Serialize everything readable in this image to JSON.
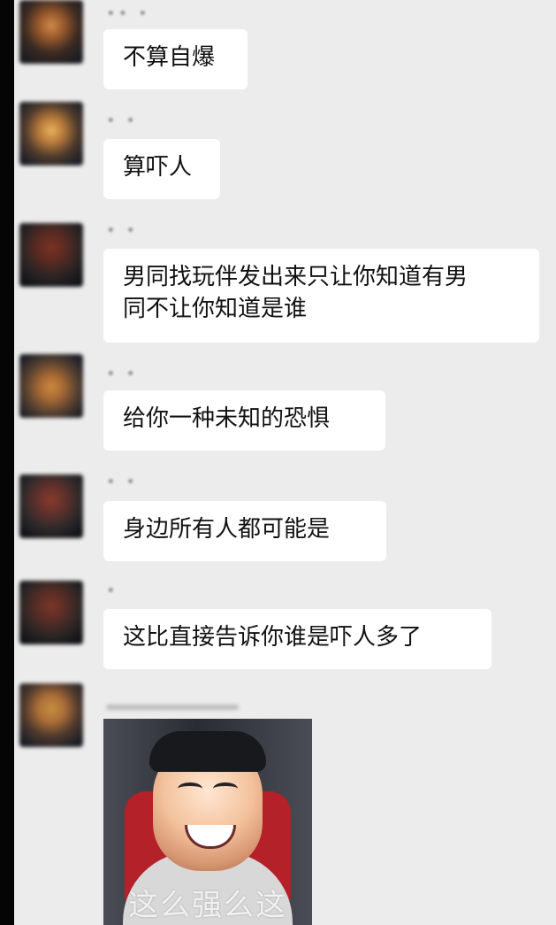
{
  "messages": [
    {
      "sender": "•• •",
      "text": "不算自爆",
      "avatar_icon": "avatar-blurred-1"
    },
    {
      "sender": "• •",
      "text": "算吓人",
      "avatar_icon": "avatar-blurred-2"
    },
    {
      "sender": "• •",
      "text_lines": [
        "男同找玩伴发出来只让你知道有男",
        "同不让你知道是谁"
      ],
      "avatar_icon": "avatar-blurred-3"
    },
    {
      "sender": "• •",
      "text": "给你一种未知的恐惧",
      "avatar_icon": "avatar-blurred-4"
    },
    {
      "sender": "• •",
      "text": "身边所有人都可能是",
      "avatar_icon": "avatar-blurred-5"
    },
    {
      "sender": "•",
      "text": "这比直接告诉你谁是吓人多了",
      "avatar_icon": "avatar-blurred-6"
    }
  ],
  "image_message": {
    "caption": "这么强么这",
    "avatar_icon": "avatar-blurred-7"
  }
}
